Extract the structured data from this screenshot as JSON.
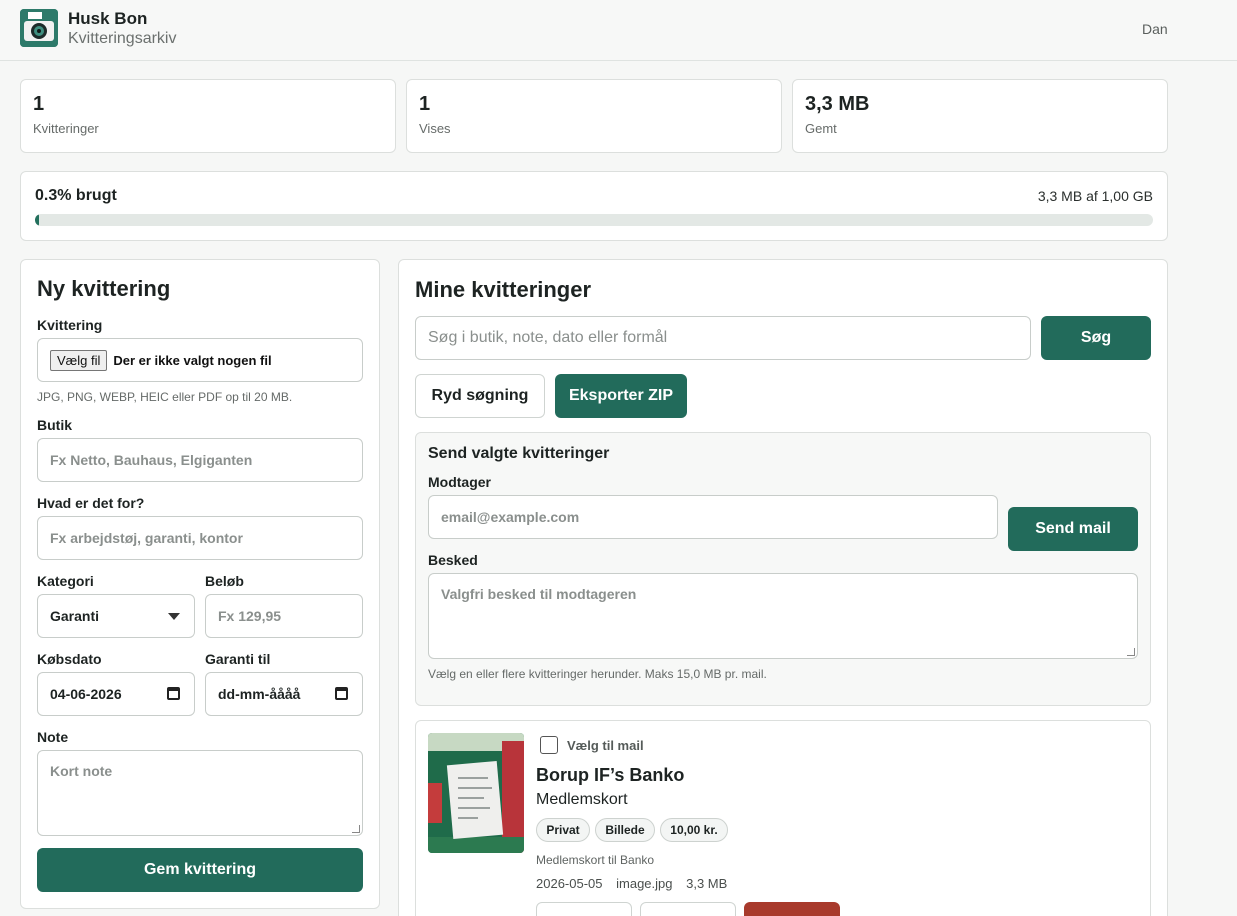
{
  "header": {
    "title": "Husk Bon",
    "subtitle": "Kvitteringsarkiv",
    "user": "Dan"
  },
  "stats": [
    {
      "value": "1",
      "label": "Kvitteringer"
    },
    {
      "value": "1",
      "label": "Vises"
    },
    {
      "value": "3,3 MB",
      "label": "Gemt"
    }
  ],
  "usage": {
    "label": "0.3% brugt",
    "detail": "3,3 MB af 1,00 GB",
    "fraction": 0.003
  },
  "form": {
    "title": "Ny kvittering",
    "receipt_label": "Kvittering",
    "file_button": "Vælg fil",
    "file_status": "Der er ikke valgt nogen fil",
    "file_hint": "JPG, PNG, WEBP, HEIC eller PDF op til 20 MB.",
    "store_label": "Butik",
    "store_placeholder": "Fx Netto, Bauhaus, Elgiganten",
    "purpose_label": "Hvad er det for?",
    "purpose_placeholder": "Fx arbejdstøj, garanti, kontor",
    "category_label": "Kategori",
    "category_value": "Garanti",
    "amount_label": "Beløb",
    "amount_placeholder": "Fx 129,95",
    "date_label": "Købsdato",
    "date_value": "04-06-2026",
    "warranty_label": "Garanti til",
    "warranty_placeholder": "dd-mm-åååå",
    "note_label": "Note",
    "note_placeholder": "Kort note",
    "save_label": "Gem kvittering"
  },
  "list": {
    "title": "Mine kvitteringer",
    "search_placeholder": "Søg i butik, note, dato eller formål",
    "search_button": "Søg",
    "clear_button": "Ryd søgning",
    "export_button": "Eksporter ZIP",
    "mail": {
      "title": "Send valgte kvitteringer",
      "recipient_label": "Modtager",
      "recipient_placeholder": "email@example.com",
      "send_button": "Send mail",
      "message_label": "Besked",
      "message_placeholder": "Valgfri besked til modtageren",
      "hint": "Vælg en eller flere kvitteringer herunder. Maks 15,0 MB pr. mail."
    },
    "items": [
      {
        "select_label": "Vælg til mail",
        "store": "Borup IF’s Banko",
        "purpose": "Medlemskort",
        "chips": [
          "Privat",
          "Billede",
          "10,00 kr."
        ],
        "note": "Medlemskort til Banko",
        "date": "2026-05-05",
        "filename": "image.jpg",
        "size": "3,3 MB"
      }
    ]
  },
  "colors": {
    "primary": "#226b5b",
    "danger": "#a83a2c",
    "background": "#f6f7f6"
  }
}
